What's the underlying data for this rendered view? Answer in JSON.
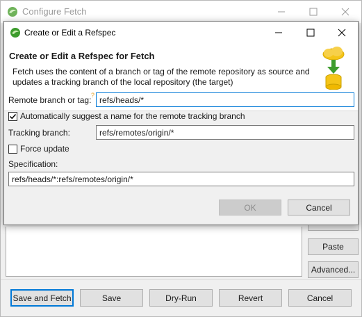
{
  "background_window": {
    "title": "Configure Fetch",
    "side_buttons": {
      "paste_label": "Paste",
      "advanced_label": "Advanced..."
    },
    "bottom_buttons": {
      "save_and_fetch": "Save and Fetch",
      "save": "Save",
      "dry_run": "Dry-Run",
      "revert": "Revert",
      "cancel": "Cancel"
    }
  },
  "dialog": {
    "title": "Create or Edit a Refspec",
    "banner": {
      "heading": "Create or Edit a Refspec for Fetch",
      "description": "Fetch uses the content of a branch or tag of the remote repository as source and updates a tracking branch of the local repository (the target)"
    },
    "remote_branch": {
      "label": "Remote branch or tag:",
      "value": "refs/heads/*"
    },
    "auto_suggest": {
      "label": "Automatically suggest a name for the remote tracking branch",
      "checked": true
    },
    "tracking_branch": {
      "label": "Tracking branch:",
      "value": "refs/remotes/origin/*"
    },
    "force_update": {
      "label": "Force update",
      "checked": false
    },
    "specification": {
      "label": "Specification:",
      "value": "refs/heads/*:refs/remotes/origin/*"
    },
    "ok_label": "OK",
    "cancel_label": "Cancel"
  },
  "colors": {
    "accent": "#0078d7",
    "eclipse_green": "#3c9c2c",
    "cloud_yellow": "#f5c518"
  }
}
